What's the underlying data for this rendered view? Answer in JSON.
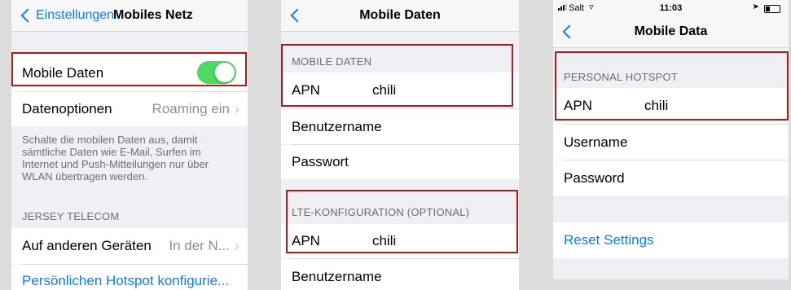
{
  "panel1": {
    "back_label": "Einstellungen",
    "title": "Mobiles Netz",
    "mobile_data_label": "Mobile Daten",
    "mobile_data_toggle": "on",
    "data_options_label": "Datenoptionen",
    "data_options_value": "Roaming ein",
    "footer_text": "Schalte die mobilen Daten aus, damit sämtliche Daten wie E-Mail, Surfen im Internet und Push-Mitteilungen nur über WLAN übertragen werden.",
    "section_header": "JERSEY TELECOM",
    "other_devices_label": "Auf anderen Geräten",
    "other_devices_value": "In der N...",
    "hotspot_link": "Persönlichen Hotspot konfigurie..."
  },
  "panel2": {
    "title": "Mobile Daten",
    "section1_header": "MOBILE DATEN",
    "apn_label": "APN",
    "apn_value": "chili",
    "username_label": "Benutzername",
    "password_label": "Passwort",
    "section2_header": "LTE-KONFIGURATION (OPTIONAL)",
    "lte_apn_label": "APN",
    "lte_apn_value": "chili",
    "lte_username_label": "Benutzername"
  },
  "panel3": {
    "carrier": "Salt",
    "time": "11:03",
    "title": "Mobile Data",
    "section_header": "PERSONAL HOTSPOT",
    "apn_label": "APN",
    "apn_value": "chili",
    "username_label": "Username",
    "password_label": "Password",
    "reset_label": "Reset Settings"
  },
  "colors": {
    "accent": "#0a7aff",
    "highlight_border": "#b21a1a",
    "toggle_on": "#4cd964"
  }
}
